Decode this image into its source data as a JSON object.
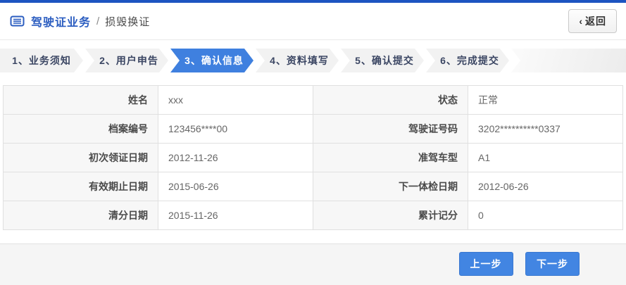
{
  "header": {
    "title": "驾驶证业务",
    "separator": "/",
    "subtitle": "损毁换证",
    "back_chevron": "‹",
    "back_label": "返回"
  },
  "steps": [
    {
      "label": "1、业务须知",
      "active": false
    },
    {
      "label": "2、用户申告",
      "active": false
    },
    {
      "label": "3、确认信息",
      "active": true
    },
    {
      "label": "4、资料填写",
      "active": false
    },
    {
      "label": "5、确认提交",
      "active": false
    },
    {
      "label": "6、完成提交",
      "active": false
    }
  ],
  "info_table": {
    "rows": [
      {
        "left_label": "姓名",
        "left_value": "xxx",
        "right_label": "状态",
        "right_value": "正常"
      },
      {
        "left_label": "档案编号",
        "left_value": "123456****00",
        "right_label": "驾驶证号码",
        "right_value": "3202**********0337"
      },
      {
        "left_label": "初次领证日期",
        "left_value": "2012-11-26",
        "right_label": "准驾车型",
        "right_value": "A1"
      },
      {
        "left_label": "有效期止日期",
        "left_value": "2015-06-26",
        "right_label": "下一体检日期",
        "right_value": "2012-06-26"
      },
      {
        "left_label": "清分日期",
        "left_value": "2015-11-26",
        "right_label": "累计记分",
        "right_value": "0"
      }
    ]
  },
  "footer": {
    "prev_button": "上一步",
    "next_button": "下一步"
  },
  "colors": {
    "top_bar_blue": "#1d54c1",
    "title_blue": "#2b5dc0",
    "active_step_blue": "#3f80df",
    "button_blue": "#4285e2",
    "step_text_navy": "#3b4663",
    "label_cell_bg": "#f7f7f7",
    "footer_bg": "#f5f5f5"
  }
}
